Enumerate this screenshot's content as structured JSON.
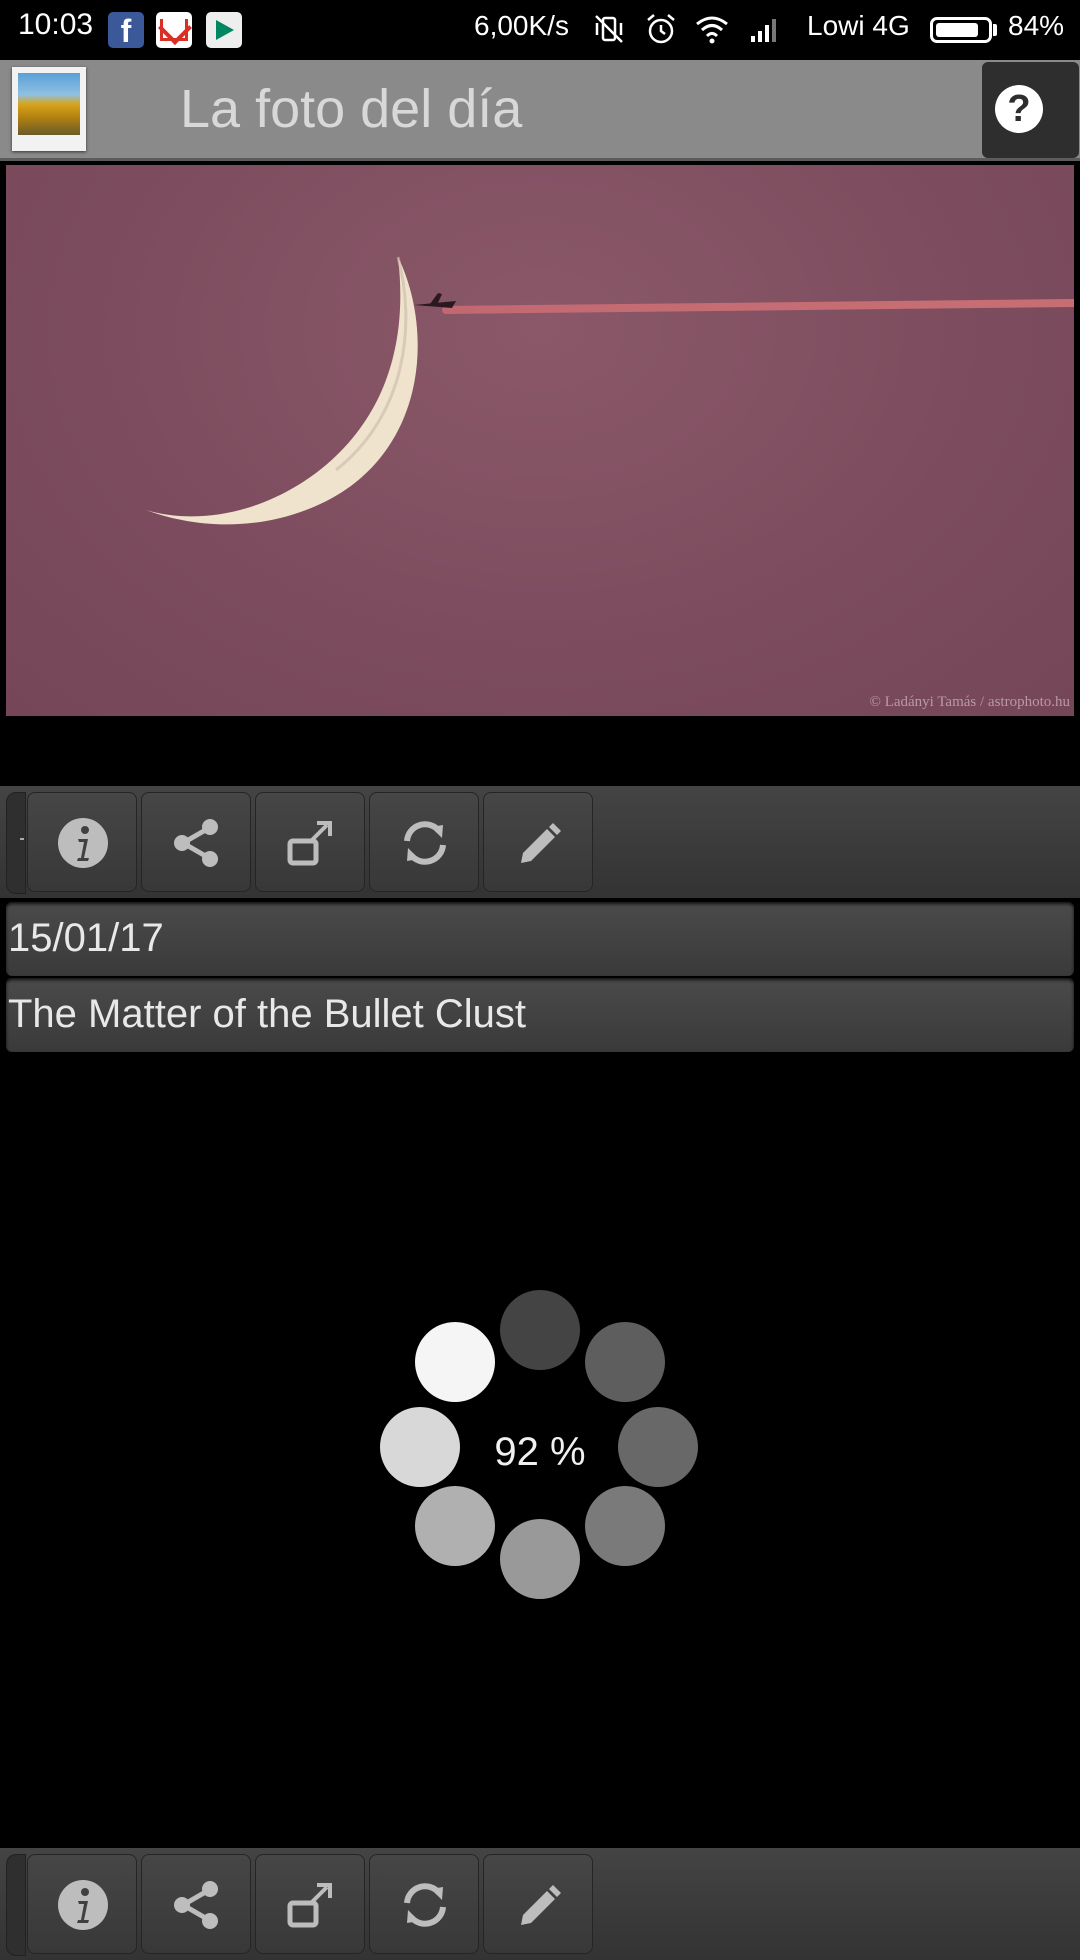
{
  "status_bar": {
    "time": "10:03",
    "network_speed": "6,00K/s",
    "carrier": "Lowi 4G",
    "battery_percent": "84%",
    "battery_level": 0.84
  },
  "header": {
    "title": "La foto del día",
    "help_symbol": "?"
  },
  "photo": {
    "credit": "© Ladányi Tamás / astrophoto.hu"
  },
  "toolbar": {
    "buttons": [
      {
        "name": "info-icon"
      },
      {
        "name": "share-icon"
      },
      {
        "name": "open-external-icon"
      },
      {
        "name": "refresh-icon"
      },
      {
        "name": "edit-icon"
      }
    ]
  },
  "entry": {
    "date": "15/01/17",
    "title": "The Matter of the Bullet Clust"
  },
  "loader": {
    "percent_text": "92 %",
    "progress": 0.92
  },
  "colors": {
    "sky": "#7d4d5f",
    "titlebar": "#8a8a8a",
    "toolbar": "#3a3a3a"
  }
}
